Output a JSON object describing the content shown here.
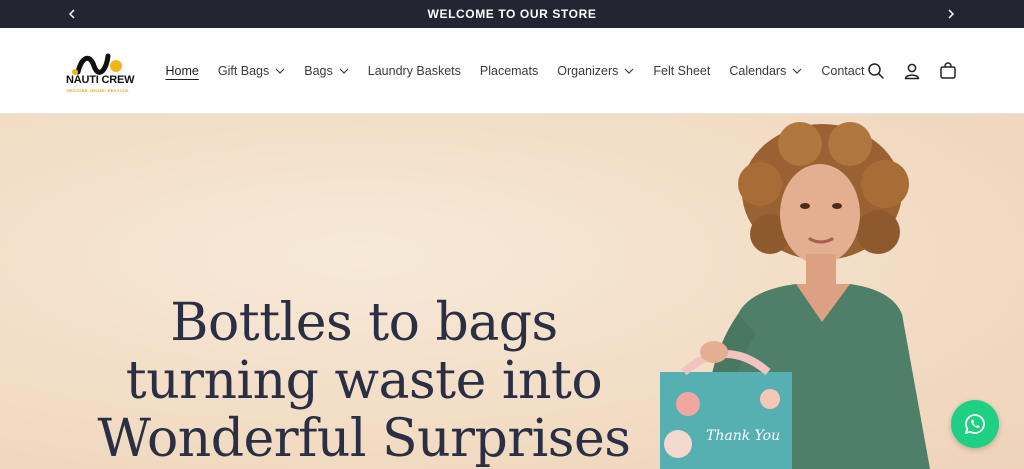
{
  "announcement": {
    "text": "WELCOME TO OUR STORE"
  },
  "logo": {
    "brand": "NAUTI CREW",
    "tagline": "RESTORE. REUSE. RECYCLE."
  },
  "nav": {
    "items": [
      {
        "label": "Home",
        "dropdown": false,
        "active": true
      },
      {
        "label": "Gift Bags",
        "dropdown": true
      },
      {
        "label": "Bags",
        "dropdown": true
      },
      {
        "label": "Laundry Baskets",
        "dropdown": false
      },
      {
        "label": "Placemats",
        "dropdown": false
      },
      {
        "label": "Organizers",
        "dropdown": true
      },
      {
        "label": "Felt Sheet",
        "dropdown": false
      },
      {
        "label": "Calendars",
        "dropdown": true
      },
      {
        "label": "Contact",
        "dropdown": false
      }
    ]
  },
  "header_icons": [
    "search-icon",
    "account-icon",
    "cart-icon"
  ],
  "hero": {
    "headline_lines": [
      "Bottles to bags",
      "turning waste into",
      "Wonderful Surprises"
    ],
    "bag_text": "Thank You"
  },
  "colors": {
    "announce_bg": "#232632",
    "hero_bg": "#f3dfc8",
    "headline": "#2b2f44",
    "whatsapp": "#1fcf83",
    "accent": "#e8a317"
  }
}
